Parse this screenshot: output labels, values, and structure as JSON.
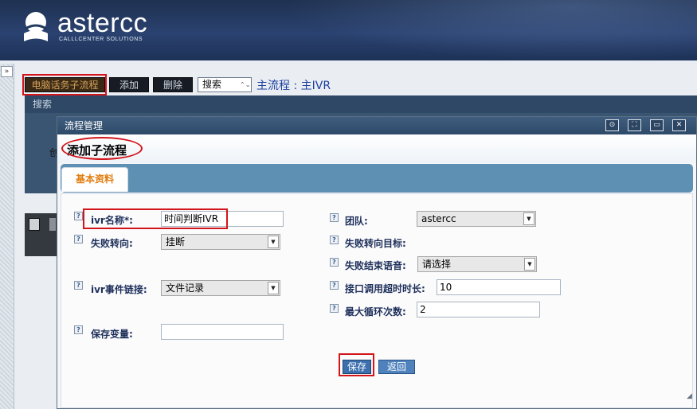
{
  "brand": {
    "name": "astercc",
    "tagline": "CALLLCENTER SOLUTIONS"
  },
  "sidebar": {
    "expand_label": "»"
  },
  "toolbar": {
    "subflow_label": "电脑话务子流程",
    "add_label": "添加",
    "delete_label": "删除",
    "search_select_value": "搜索",
    "main_flow_label": "主流程 : 主IVR"
  },
  "search": {
    "bar_label": "搜索",
    "panel_text": "创"
  },
  "dialog": {
    "title": "流程管理",
    "heading": "添加子流程",
    "tab_label": "基本资料",
    "controls": [
      "⊙",
      "⛶",
      "▭",
      "✕"
    ]
  },
  "form": {
    "ivr_name_label": "ivr名称*:",
    "ivr_name_value": "时间判断IVR",
    "fail_route_label": "失败转向:",
    "fail_route_value": "挂断",
    "ivr_event_label": "ivr事件链接:",
    "ivr_event_value": "文件记录",
    "save_var_label": "保存变量:",
    "save_var_value": "",
    "team_label": "团队:",
    "team_value": "astercc",
    "fail_target_label": "失败转向目标:",
    "fail_end_voice_label": "失败结束语音:",
    "fail_end_voice_value": "请选择",
    "timeout_label": "接口调用超时时长:",
    "timeout_value": "10",
    "max_loop_label": "最大循环次数:",
    "max_loop_value": "2",
    "help_glyph": "?"
  },
  "actions": {
    "save_label": "保存",
    "back_label": "返回"
  },
  "colors": {
    "highlight": "#d3141a",
    "header": "#223a5e",
    "tab_bar": "#5e90b4",
    "tab_text": "#e07d0e"
  }
}
